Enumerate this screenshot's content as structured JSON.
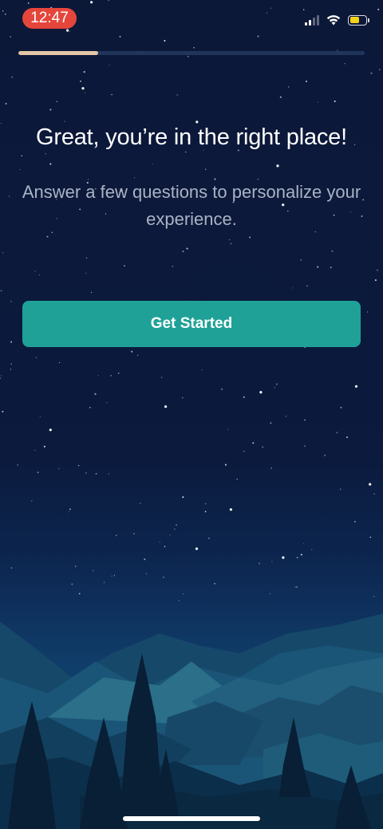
{
  "status_bar": {
    "time": "12:47",
    "time_pill_color": "#e5463b",
    "signal_icon": "cellular-signal-icon",
    "wifi_icon": "wifi-icon",
    "battery_icon": "battery-icon",
    "battery_color": "#f7d21c",
    "battery_level": 0.6
  },
  "progress": {
    "value": 0.23,
    "fill_color": "#e3c6a6"
  },
  "content": {
    "headline": "Great, you’re in the right place!",
    "subtext": "Answer a few questions to personalize your experience.",
    "cta_label": "Get Started",
    "cta_color": "#1fa198"
  }
}
